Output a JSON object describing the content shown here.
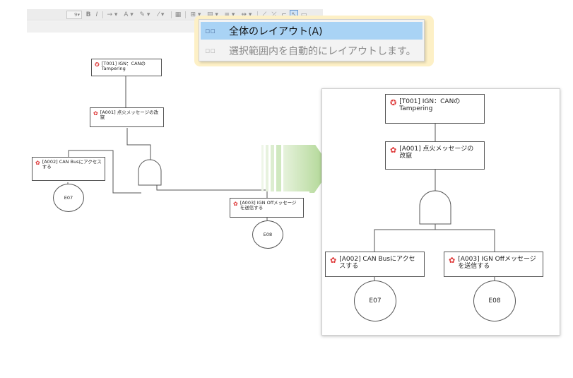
{
  "toolbar": {
    "size_combo": "9",
    "bold": "B",
    "italic": "I",
    "arrow_style": "→ ▾",
    "font_color": "A ▾",
    "fill_color": "✎ ▾",
    "line_color": "⁄ ▾",
    "layout_btn": "⊞ ▾",
    "align_btn": "▤ ▾",
    "dist_btn": "≡ ▾",
    "connect_btn": "⇹ ▾"
  },
  "context_menu": {
    "items": [
      {
        "label": "全体のレイアウト(A)",
        "icon": "layout-all-icon",
        "enabled": true,
        "selected": true
      },
      {
        "label": "選択範囲内を自動的にレイアウトします。",
        "icon": "layout-selection-icon",
        "enabled": false,
        "selected": false
      }
    ]
  },
  "diagram_before": {
    "nodes": {
      "t001": "[T001] IGN：CANの Tampering",
      "a001": "[A001] 点火メッセージの改竄",
      "a002": "[A002] CAN Busにアクセスする",
      "a003": "[A003] IGN Offメッセージを送信する"
    },
    "events": {
      "e07": "E07",
      "e08": "E08"
    }
  },
  "diagram_after": {
    "nodes": {
      "t001": "[T001] IGN：CANの Tampering",
      "a001": "[A001] 点火メッセージの改竄",
      "a002": "[A002] CAN Busにアクセスする",
      "a003": "[A003] IGN Offメッセージを送信する"
    },
    "events": {
      "e07": "E07",
      "e08": "E08"
    }
  },
  "colors": {
    "menu_highlight": "#a9d3f5",
    "menu_halo": "#fdf0c6",
    "attack_icon": "#dd3333",
    "arrow_green": "#a9d38a"
  }
}
